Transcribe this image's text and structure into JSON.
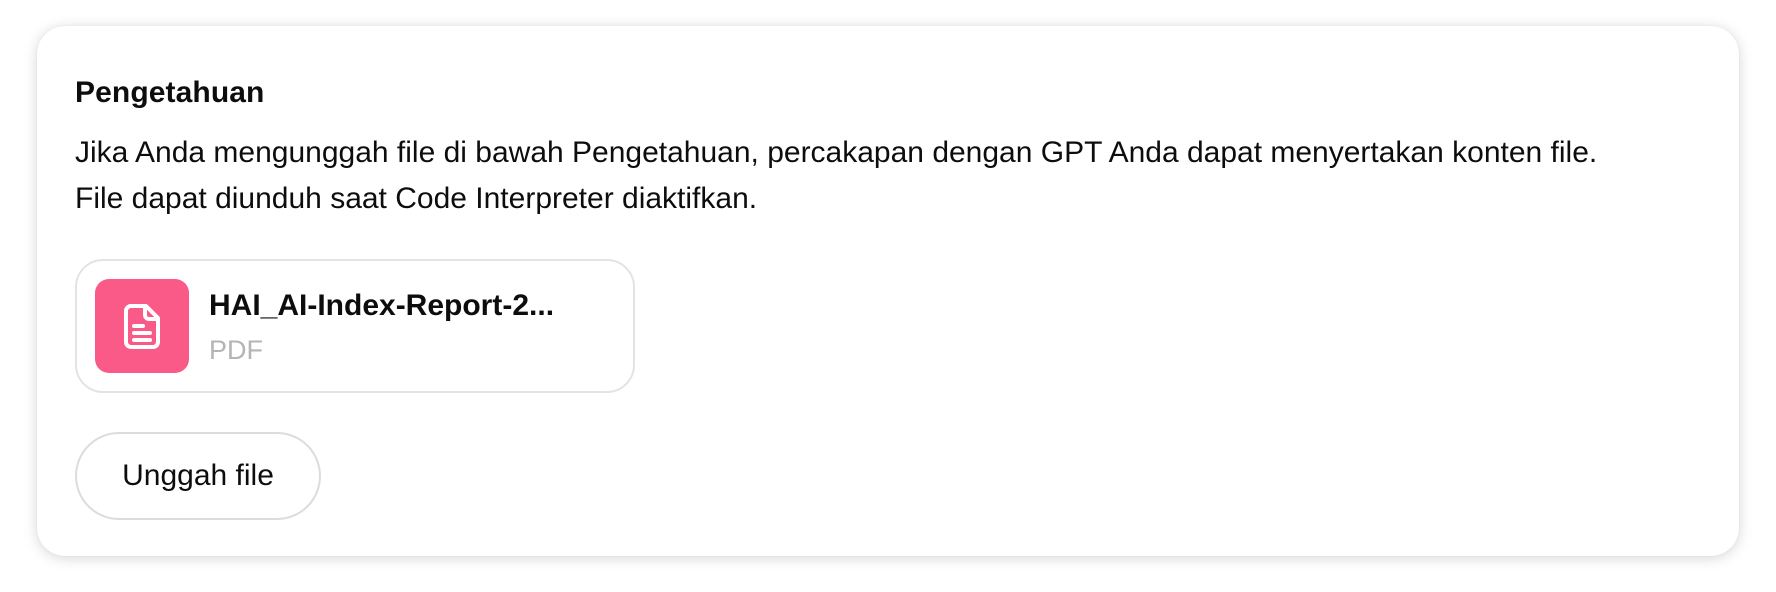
{
  "knowledge": {
    "title": "Pengetahuan",
    "description": "Jika Anda mengunggah file di bawah Pengetahuan, percakapan dengan GPT Anda dapat menyertakan konten file. File dapat diunduh saat Code Interpreter diaktifkan.",
    "files": [
      {
        "name": "HAI_AI-Index-Report-2...",
        "type": "PDF",
        "icon": "document-icon",
        "icon_color": "#fa5a87"
      }
    ],
    "upload_label": "Unggah file"
  }
}
